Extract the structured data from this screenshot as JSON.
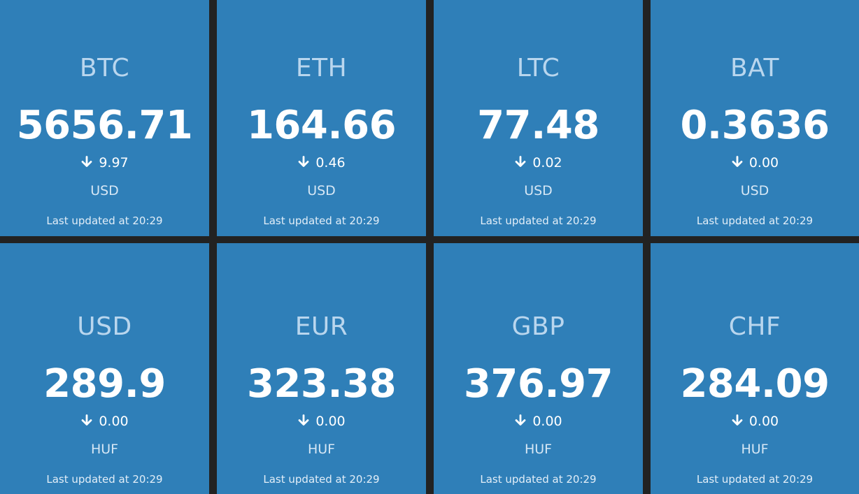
{
  "tiles": [
    {
      "symbol": "BTC",
      "price": "5656.71",
      "change": "9.97",
      "direction": "down",
      "quote": "USD",
      "updated_label": "Last updated at 20:29"
    },
    {
      "symbol": "ETH",
      "price": "164.66",
      "change": "0.46",
      "direction": "down",
      "quote": "USD",
      "updated_label": "Last updated at 20:29"
    },
    {
      "symbol": "LTC",
      "price": "77.48",
      "change": "0.02",
      "direction": "down",
      "quote": "USD",
      "updated_label": "Last updated at 20:29"
    },
    {
      "symbol": "BAT",
      "price": "0.3636",
      "change": "0.00",
      "direction": "down",
      "quote": "USD",
      "updated_label": "Last updated at 20:29"
    },
    {
      "symbol": "USD",
      "price": "289.9",
      "change": "0.00",
      "direction": "down",
      "quote": "HUF",
      "updated_label": "Last updated at 20:29"
    },
    {
      "symbol": "EUR",
      "price": "323.38",
      "change": "0.00",
      "direction": "down",
      "quote": "HUF",
      "updated_label": "Last updated at 20:29"
    },
    {
      "symbol": "GBP",
      "price": "376.97",
      "change": "0.00",
      "direction": "down",
      "quote": "HUF",
      "updated_label": "Last updated at 20:29"
    },
    {
      "symbol": "CHF",
      "price": "284.09",
      "change": "0.00",
      "direction": "down",
      "quote": "HUF",
      "updated_label": "Last updated at 20:29"
    }
  ],
  "colors": {
    "tile_background": "#2f7fb8",
    "gutter": "#222222",
    "symbol_text": "#b9d6ee",
    "price_text": "#ffffff"
  },
  "icons": {
    "change_down": "arrow-down-icon"
  }
}
